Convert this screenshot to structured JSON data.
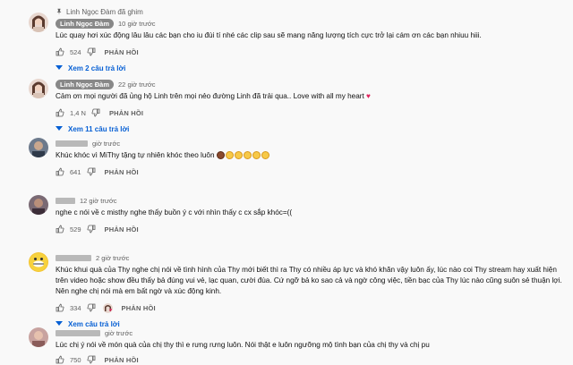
{
  "comments": [
    {
      "pinned_text": "Linh Ngọc Đàm đã ghim",
      "author": "Linh Ngọc Đàm",
      "time": "10 giờ trước",
      "text": "Lúc quay hơi xúc động lâu lâu các bạn cho iu đùi tí nhé các clip sau sẽ mang năng lượng tích cực trở lại cám ơn các bạn nhiuu hiii.",
      "likes": "524",
      "reply_label": "PHẢN HỒI",
      "replies_label": "Xem 2 câu trả lời"
    },
    {
      "author": "Linh Ngọc Đàm",
      "time": "22 giờ trước",
      "text": "Cảm ơn mọi người đã ủng hộ Linh trên mọi nẻo đường Linh đã trải qua.. Love with all my heart",
      "likes": "1,4 N",
      "reply_label": "PHẢN HỒI",
      "replies_label": "Xem 11 câu trả lời"
    },
    {
      "time": "giờ trước",
      "text": "Khúc khóc vì MiThy tặng tự nhiên khóc theo luôn",
      "likes": "641",
      "reply_label": "PHẢN HỒI"
    },
    {
      "time": "12 giờ trước",
      "text": "nghe c nói về c misthy nghe thấy buồn ý c với nhìn thấy c cx sắp khóc=((",
      "likes": "529",
      "reply_label": "PHẢN HỒI"
    },
    {
      "time": "2 giờ trước",
      "text": "Khúc khui quà của Thy nghe chị nói về tình hình của Thy mới biết thì ra Thy có nhiều áp lực và khó khăn vậy luôn ấy, lúc nào coi Thy stream hay xuất hiện trên video hoặc show đều thấy bả đúng vui vẻ, lạc quan, cười đùa. Cứ ngỡ bả ko sao cả và ngờ công việc, tiền bạc của Thy lúc nào cũng suôn sẻ thuận lợi. Nên nghe chị nói mà em bất ngờ và xúc động kinh.",
      "likes": "334",
      "reply_label": "PHẢN HỒI",
      "replies_label": "Xem câu trả lời"
    },
    {
      "time": "giờ trước",
      "text": "Lúc chị ý nói về món quà của chị thy thì e rưng rưng luôn. Nói thật e luôn ngưỡng mộ tình bạn của chị thy và chị pu",
      "likes": "750",
      "reply_label": "PHẢN HỒI"
    }
  ]
}
